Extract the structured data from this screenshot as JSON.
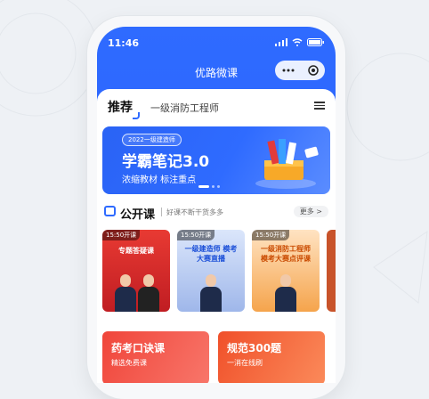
{
  "status": {
    "time": "11:46"
  },
  "nav": {
    "title": "优路微课"
  },
  "tabs": {
    "active": "推荐",
    "second": "一级消防工程师"
  },
  "banner": {
    "chip": "2022一级建造师",
    "title": "学霸笔记3.0",
    "subtitle": "浓缩教材 标注重点"
  },
  "section": {
    "title": "公开课",
    "subtitle": "好课不断干货多多",
    "more": "更多 >"
  },
  "courses": [
    {
      "time": "15:50开课",
      "title": "专题答疑课",
      "color": "#d9272d"
    },
    {
      "time": "15:50开课",
      "title": "一级建造师 模考大赛直播",
      "color": "#8fa9e0"
    },
    {
      "time": "15:50开课",
      "title": "一级消防工程师 模考大赛点评课",
      "color": "#f19a3a"
    }
  ],
  "bottom_cards": [
    {
      "title": "药考口诀课",
      "subtitle": "精选免费课",
      "color": "#ee3b2f"
    },
    {
      "title": "规范300题",
      "subtitle": "一消在线刷",
      "color": "#f05a2a"
    }
  ]
}
